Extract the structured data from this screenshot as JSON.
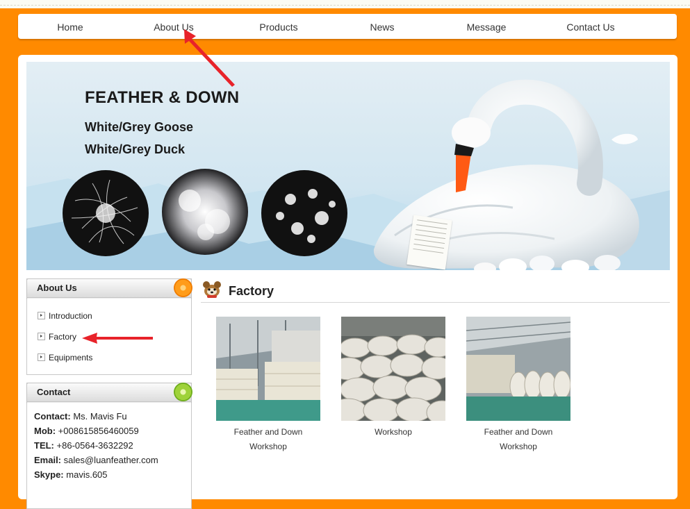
{
  "nav": {
    "items": [
      "Home",
      "About Us",
      "Products",
      "News",
      "Message",
      "Contact Us"
    ]
  },
  "banner": {
    "title": "FEATHER & DOWN",
    "subtitle_1": "White/Grey Goose",
    "subtitle_2": "White/Grey Duck"
  },
  "sidebar": {
    "about": {
      "title": "About Us",
      "items": [
        "Introduction",
        "Factory",
        "Equipments"
      ]
    },
    "contact": {
      "title": "Contact",
      "rows": [
        {
          "label": "Contact:",
          "value": "Ms. Mavis Fu"
        },
        {
          "label": "Mob:",
          "value": "+008615856460059"
        },
        {
          "label": "TEL:",
          "value": "+86-0564-3632292"
        },
        {
          "label": "Email:",
          "value": "sales@luanfeather.com"
        },
        {
          "label": "Skype:",
          "value": "mavis.605"
        }
      ]
    }
  },
  "main": {
    "section_title": "Factory",
    "gallery": [
      {
        "line1": "Feather and Down",
        "line2": "Workshop"
      },
      {
        "line1": "Workshop",
        "line2": ""
      },
      {
        "line1": "Feather and Down",
        "line2": "Workshop"
      }
    ]
  },
  "colors": {
    "page_background": "#ff8a00",
    "annotation_arrow": "#e8232a"
  },
  "icons": {
    "section_icon": "plush-toy-icon",
    "menu_bullet": "arrow-right-icon",
    "about_header_decor": "orange-slice-icon",
    "contact_header_decor": "lime-slice-icon"
  }
}
